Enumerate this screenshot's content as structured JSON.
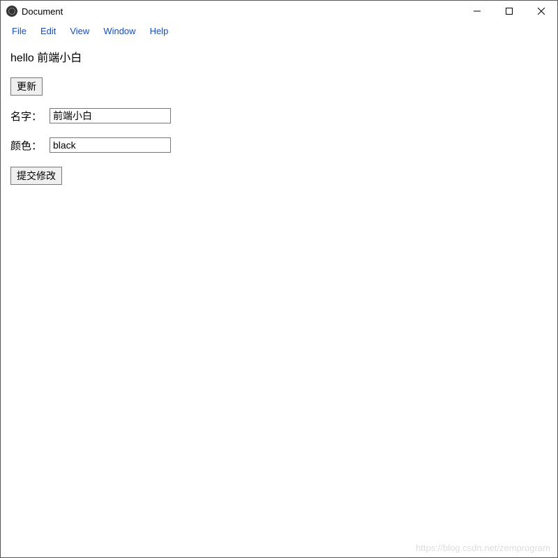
{
  "window": {
    "title": "Document"
  },
  "menu": {
    "items": [
      "File",
      "Edit",
      "View",
      "Window",
      "Help"
    ]
  },
  "content": {
    "greeting": "hello 前端小白",
    "update_button": "更新",
    "name_label": "名字：",
    "name_value": "前端小白",
    "color_label": "颜色：",
    "color_value": "black",
    "submit_button": "提交修改"
  },
  "watermark": "https://blog.csdn.net/zemprogram"
}
